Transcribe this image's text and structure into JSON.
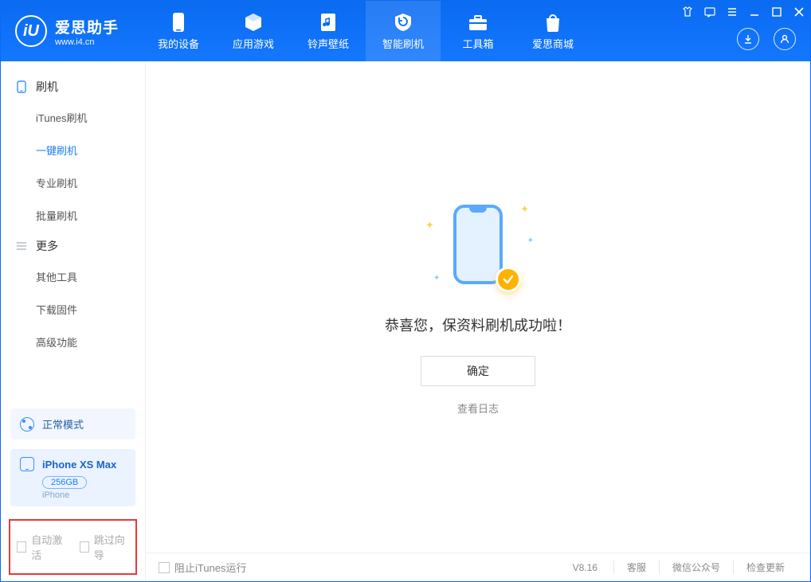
{
  "brand": {
    "title": "爱思助手",
    "subtitle": "www.i4.cn",
    "logo_letter": "iU"
  },
  "tabs": [
    {
      "label": "我的设备"
    },
    {
      "label": "应用游戏"
    },
    {
      "label": "铃声壁纸"
    },
    {
      "label": "智能刷机"
    },
    {
      "label": "工具箱"
    },
    {
      "label": "爱思商城"
    }
  ],
  "active_tab_index": 3,
  "sidebar": {
    "groups": [
      {
        "title": "刷机",
        "items": [
          "iTunes刷机",
          "一键刷机",
          "专业刷机",
          "批量刷机"
        ],
        "active_index": 1
      },
      {
        "title": "更多",
        "items": [
          "其他工具",
          "下载固件",
          "高级功能"
        ],
        "active_index": -1
      }
    ],
    "mode": {
      "label": "正常模式"
    },
    "device": {
      "name": "iPhone XS Max",
      "capacity": "256GB",
      "type": "iPhone"
    },
    "options": {
      "opt1": "自动激活",
      "opt2": "跳过向导"
    }
  },
  "main": {
    "message": "恭喜您，保资料刷机成功啦！",
    "ok_label": "确定",
    "log_link": "查看日志"
  },
  "footer": {
    "block_itunes": "阻止iTunes运行",
    "version": "V8.16",
    "links": [
      "客服",
      "微信公众号",
      "检查更新"
    ]
  },
  "colors": {
    "brand": "#0a6bf1",
    "accent": "#1a7bff",
    "badge": "#ffb300"
  }
}
